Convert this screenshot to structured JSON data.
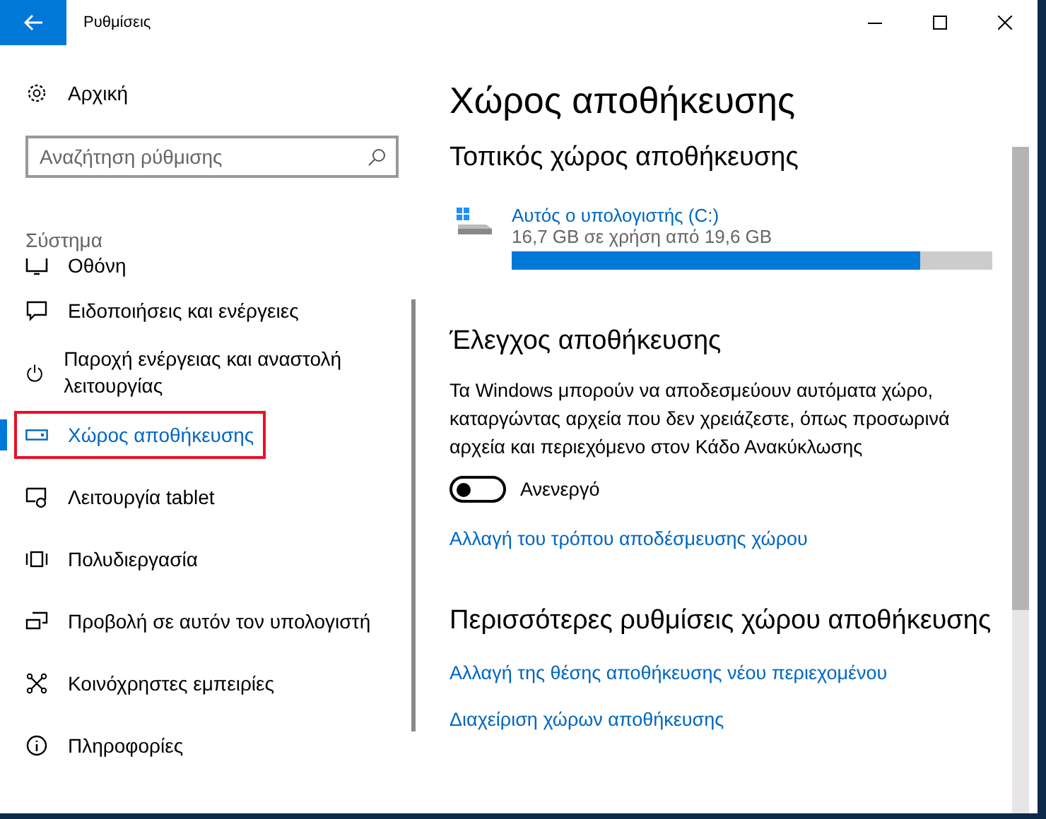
{
  "window": {
    "title": "Ρυθμίσεις"
  },
  "sidebar": {
    "home": "Αρχική",
    "search": {
      "placeholder": "Αναζήτηση ρύθμισης"
    },
    "section": "Σύστημα",
    "items": [
      {
        "label": "Οθόνη",
        "selected": false
      },
      {
        "label": "Ειδοποιήσεις και ενέργειες",
        "selected": false
      },
      {
        "label": "Παροχή ενέργειας και αναστολή λειτουργίας",
        "selected": false
      },
      {
        "label": "Χώρος αποθήκευσης",
        "selected": true
      },
      {
        "label": "Λειτουργία tablet",
        "selected": false
      },
      {
        "label": "Πολυδιεργασία",
        "selected": false
      },
      {
        "label": "Προβολή σε αυτόν τον υπολογιστή",
        "selected": false
      },
      {
        "label": "Κοινόχρηστες εμπειρίες",
        "selected": false
      },
      {
        "label": "Πληροφορίες",
        "selected": false
      }
    ]
  },
  "content": {
    "title": "Χώρος αποθήκευσης",
    "local_heading": "Τοπικός χώρος αποθήκευσης",
    "drive": {
      "name": "Αυτός ο υπολογιστής (C:)",
      "usage": "16,7 GB σε χρήση από 19,6 GB",
      "level": 0.85
    },
    "sense_heading": "Έλεγχος αποθήκευσης",
    "sense_text": "Τα Windows μπορούν να αποδεσμεύουν αυτόματα χώρο, καταργώντας αρχεία που δεν χρειάζεστε, όπως προσωρινά αρχεία και περιεχόμενο στον Κάδο Ανακύκλωσης",
    "toggle": {
      "on": false,
      "label": "Ανενεργό"
    },
    "sense_link": "Αλλαγή του τρόπου αποδέσμευσης χώρου",
    "more_heading": "Περισσότερες ρυθμίσεις χώρου αποθήκευσης",
    "more_links": [
      "Αλλαγή της θέσης αποθήκευσης νέου περιεχομένου",
      "Διαχείριση χώρων αποθήκευσης"
    ]
  }
}
